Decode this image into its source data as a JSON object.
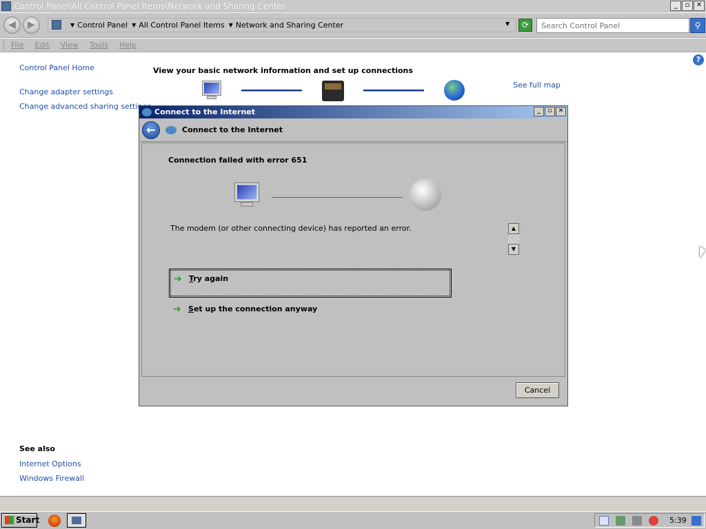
{
  "window": {
    "title": "Control Panel\\All Control Panel Items\\Network and Sharing Center",
    "minimize": "_",
    "maximize": "▫",
    "close": "✕"
  },
  "address": {
    "breadcrumbs": [
      "Control Panel",
      "All Control Panel Items",
      "Network and Sharing Center"
    ],
    "search_placeholder": "Search Control Panel"
  },
  "menu": {
    "items": [
      "File",
      "Edit",
      "View",
      "Tools",
      "Help"
    ]
  },
  "sidebar": {
    "home": "Control Panel Home",
    "links": [
      "Change adapter settings",
      "Change advanced sharing settings"
    ]
  },
  "main": {
    "heading": "View your basic network information and set up connections",
    "see_full_map": "See full map"
  },
  "see_also": {
    "title": "See also",
    "links": [
      "Internet Options",
      "Windows Firewall"
    ]
  },
  "dialog": {
    "title": "Connect to the Internet",
    "header_title": "Connect to the Internet",
    "error_title": "Connection failed with error 651",
    "error_message": "The modem (or other connecting device) has reported an error.",
    "options": [
      {
        "hotkey": "T",
        "rest": "ry again"
      },
      {
        "hotkey": "S",
        "rest": "et up the connection anyway"
      }
    ],
    "cancel": "Cancel"
  },
  "taskbar": {
    "start": "Start",
    "clock": "5:39"
  },
  "colors": {
    "link": "#1e4fa8",
    "dialog_title_start": "#0a246a",
    "dialog_title_end": "#a6caf0",
    "option_arrow": "#2a9a2a"
  }
}
